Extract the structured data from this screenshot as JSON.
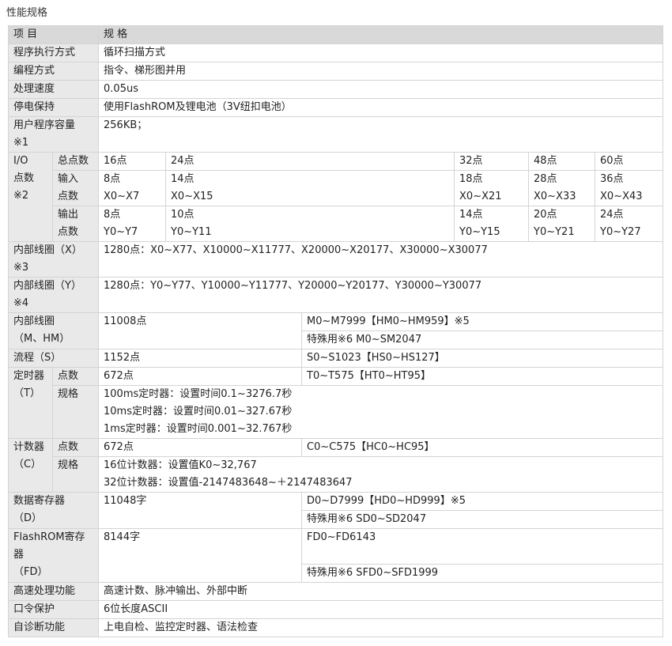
{
  "page_title": "性能规格",
  "header": {
    "item": "项 目",
    "spec": "规 格"
  },
  "exec_method": {
    "label": "程序执行方式",
    "value": "循环扫描方式"
  },
  "prog_method": {
    "label": "编程方式",
    "value": "指令、梯形图并用"
  },
  "speed": {
    "label": "处理速度",
    "value": "0.05us"
  },
  "power_hold": {
    "label": "停电保持",
    "value": "使用FlashROM及锂电池（3V纽扣电池）"
  },
  "capacity": {
    "label1": "用户程序容量",
    "label2": "※1",
    "value": "256KB；"
  },
  "io": {
    "label1": "I/O",
    "label2": "点数",
    "label3": "※2",
    "total": {
      "label": "总点数",
      "values": [
        "16点",
        "24点",
        "32点",
        "48点",
        "60点"
      ]
    },
    "input": {
      "label1": "输入",
      "label2": "点数",
      "counts": [
        "8点",
        "14点",
        "18点",
        "28点",
        "36点"
      ],
      "ranges": [
        "X0~X7",
        "X0~X15",
        "X0~X21",
        "X0~X33",
        "X0~X43"
      ]
    },
    "output": {
      "label1": "输出",
      "label2": "点数",
      "counts": [
        "8点",
        "10点",
        "14点",
        "20点",
        "24点"
      ],
      "ranges": [
        "Y0~Y7",
        "Y0~Y11",
        "Y0~Y15",
        "Y0~Y21",
        "Y0~Y27"
      ]
    }
  },
  "coil_x": {
    "label1": "内部线圈（X）",
    "label2": "※3",
    "value": "1280点：X0~X77、X10000~X11777、X20000~X20177、X30000~X30077"
  },
  "coil_y": {
    "label1": "内部线圈（Y）",
    "label2": "※4",
    "value": "1280点：Y0~Y77、Y10000~Y11777、Y20000~Y20177、Y30000~Y30077"
  },
  "coil_m": {
    "label1": "内部线圈",
    "label2": "（M、HM）",
    "count": "11008点",
    "range1": "M0~M7999【HM0~HM959】※5",
    "range2": "特殊用※6  M0~SM2047"
  },
  "flow": {
    "label": "流程（S）",
    "count": "1152点",
    "range": "S0~S1023【HS0~HS127】"
  },
  "timer": {
    "label1": "定时器",
    "label2": "（T）",
    "points_label": "点数",
    "count": "672点",
    "range": "T0~T575【HT0~HT95】",
    "spec_label": "规格",
    "specs": [
      "100ms定时器：设置时间0.1~3276.7秒",
      "10ms定时器：设置时间0.01~327.67秒",
      "1ms定时器：设置时间0.001~32.767秒"
    ]
  },
  "counter": {
    "label1": "计数器",
    "label2": "（C）",
    "points_label": "点数",
    "count": "672点",
    "range": "C0~C575【HC0~HC95】",
    "spec_label": "规格",
    "specs": [
      "16位计数器：设置值K0~32,767",
      "32位计数器：设置值-2147483648~＋2147483647"
    ]
  },
  "data_reg": {
    "label1": "数据寄存器",
    "label2": "（D）",
    "count": "11048字",
    "range1": "D0~D7999【HD0~HD999】※5",
    "range2": "特殊用※6  SD0~SD2047"
  },
  "flash_reg": {
    "label1": "FlashROM寄存",
    "label2": "器",
    "label3": "（FD）",
    "count": "8144字",
    "range1": "FD0~FD6143",
    "range2": "特殊用※6  SFD0~SFD1999"
  },
  "high_speed": {
    "label": "高速处理功能",
    "value": "高速计数、脉冲输出、外部中断"
  },
  "password": {
    "label": "口令保护",
    "value": "6位长度ASCII"
  },
  "self_diag": {
    "label": "自诊断功能",
    "value": "上电自检、监控定时器、语法检查"
  }
}
